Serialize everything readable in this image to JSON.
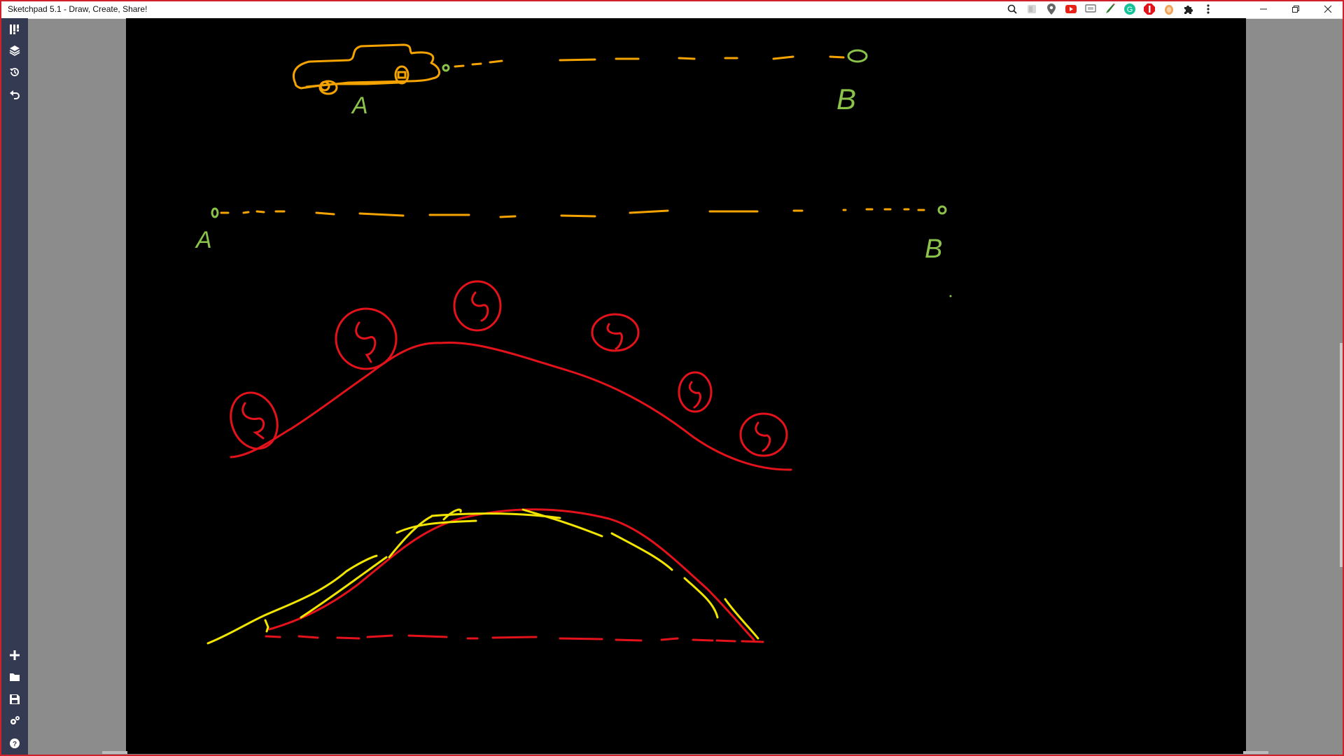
{
  "window": {
    "title": "Sketchpad 5.1 - Draw, Create, Share!",
    "controls": [
      "minimize",
      "restore",
      "close"
    ]
  },
  "browser_extensions": [
    {
      "name": "zoom-icon"
    },
    {
      "name": "extension-gray-icon"
    },
    {
      "name": "map-pin-icon"
    },
    {
      "name": "youtube-icon"
    },
    {
      "name": "cast-icon"
    },
    {
      "name": "pen-extension-icon"
    },
    {
      "name": "grammarly-icon"
    },
    {
      "name": "adblock-icon"
    },
    {
      "name": "orange-extension-icon"
    },
    {
      "name": "puzzle-icon"
    },
    {
      "name": "kebab-menu-icon"
    }
  ],
  "sidebar_top_tools": [
    {
      "name": "brush-tools-icon"
    },
    {
      "name": "layers-icon"
    },
    {
      "name": "history-icon"
    },
    {
      "name": "undo-icon"
    }
  ],
  "sidebar_bottom_tools": [
    {
      "name": "new-plus-icon"
    },
    {
      "name": "open-folder-icon"
    },
    {
      "name": "save-icon"
    },
    {
      "name": "settings-gears-icon"
    },
    {
      "name": "help-icon"
    }
  ],
  "colors": {
    "orange_stroke": "#f5a300",
    "green_stroke": "#8bc34a",
    "red_stroke": "#e3121b",
    "yellow_stroke": "#f2e500",
    "canvas": "#000000",
    "sidebar": "#343a52"
  },
  "sketch_labels": {
    "top_a": "A",
    "top_b": "B",
    "mid_a": "A",
    "mid_b": "B"
  }
}
